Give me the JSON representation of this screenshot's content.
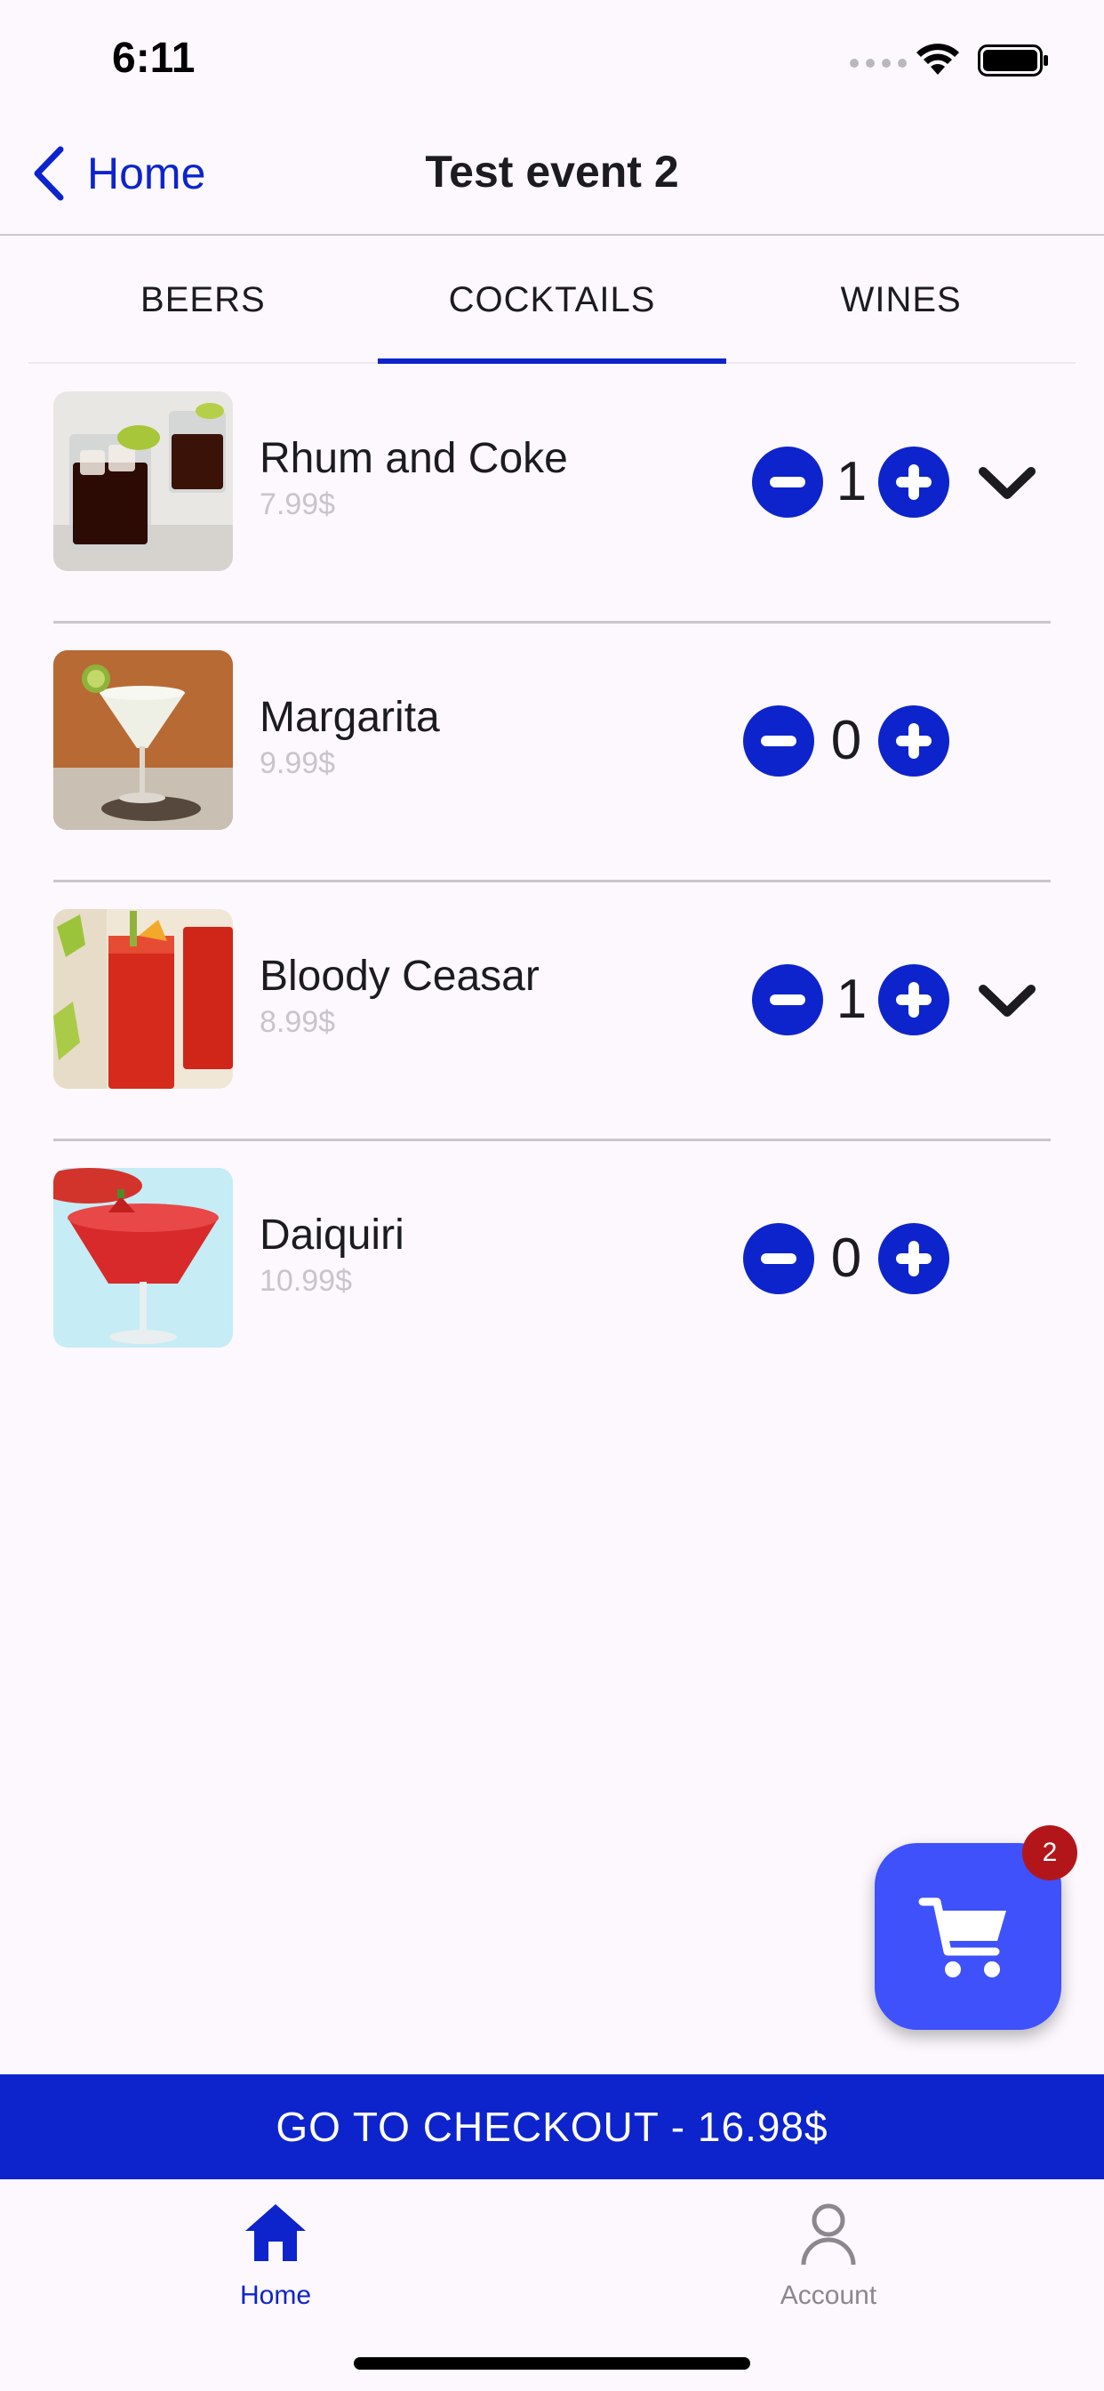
{
  "status_bar": {
    "time": "6:11"
  },
  "nav": {
    "back_label": "Home",
    "title": "Test event 2"
  },
  "tabs": [
    {
      "label": "BEERS",
      "active": false
    },
    {
      "label": "COCKTAILS",
      "active": true
    },
    {
      "label": "WINES",
      "active": false
    }
  ],
  "items": [
    {
      "name": "Rhum and Coke",
      "price": "7.99$",
      "quantity": "1",
      "expandable": true,
      "image": "rum-and-coke-glasses"
    },
    {
      "name": "Margarita",
      "price": "9.99$",
      "quantity": "0",
      "expandable": false,
      "image": "margarita-glass"
    },
    {
      "name": "Bloody Ceasar",
      "price": "8.99$",
      "quantity": "1",
      "expandable": true,
      "image": "bloody-caesar-glasses"
    },
    {
      "name": "Daiquiri",
      "price": "10.99$",
      "quantity": "0",
      "expandable": false,
      "image": "strawberry-daiquiri-glass"
    }
  ],
  "cart": {
    "badge": "2",
    "icon": "cart-icon"
  },
  "checkout": {
    "label": "GO TO CHECKOUT - 16.98$"
  },
  "bottom_nav": [
    {
      "label": "Home",
      "icon": "home-icon",
      "active": true
    },
    {
      "label": "Account",
      "icon": "account-icon",
      "active": false
    }
  ],
  "colors": {
    "accent": "#0d24cc",
    "fab": "#3e51fb",
    "badge": "#b3161a",
    "background": "#fcf8fd"
  }
}
